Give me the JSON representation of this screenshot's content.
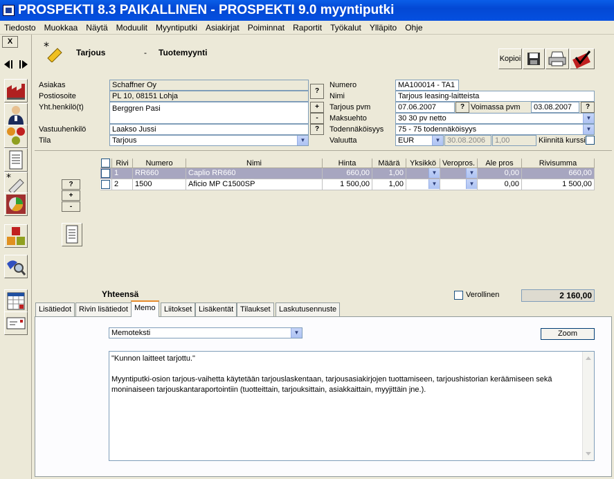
{
  "window": {
    "title": "PROSPEKTI 8.3 PAIKALLINEN - PROSPEKTI 9.0 myyntiputki"
  },
  "menu": [
    "Tiedosto",
    "Muokkaa",
    "Näytä",
    "Moduulit",
    "Myyntiputki",
    "Asiakirjat",
    "Poiminnat",
    "Raportit",
    "Työkalut",
    "Ylläpito",
    "Ohje"
  ],
  "close_label": "X",
  "header": {
    "module": "Tarjous",
    "separator": "-",
    "type": "Tuotemyynti",
    "copy_label": "Kopioi"
  },
  "form": {
    "asiakas_label": "Asiakas",
    "asiakas": "Schaffner Oy",
    "postiosoite_label": "Postiosoite",
    "postiosoite": "PL 10, 08151 Lohja",
    "yht_label": "Yht.henkilö(t)",
    "yht": "Berggren Pasi",
    "vastuu_label": "Vastuuhenkilö",
    "vastuu": "Laakso Jussi",
    "tila_label": "Tila",
    "tila": "Tarjous",
    "numero_label": "Numero",
    "numero": "MA100014 - TA1",
    "nimi_label": "Nimi",
    "nimi": "Tarjous leasing-laitteista",
    "pvm_label": "Tarjous pvm",
    "pvm": "07.06.2007",
    "voimassa_label": "Voimassa pvm",
    "voimassa": "03.08.2007",
    "maksuehto_label": "Maksuehto",
    "maksuehto": "30 30 pv netto",
    "todnak_label": "Todennäköisyys",
    "todnak": "75 - 75 todennäköisyys",
    "valuutta_label": "Valuutta",
    "valuutta": "EUR",
    "valuutta_pvm": "30.08.2006",
    "kurssi": "1,00",
    "kiinnita_label": "Kiinnitä kurssi",
    "q": "?",
    "plus": "+",
    "minus": "-"
  },
  "grid": {
    "headers": [
      "Rivi",
      "Numero",
      "Nimi",
      "Hinta",
      "Määrä",
      "Yksikkö",
      "Veropros.",
      "Ale pros",
      "Rivisumma"
    ],
    "rows": [
      {
        "rivi": "1",
        "numero": "RR660",
        "nimi": "Caplio RR660",
        "hinta": "660,00",
        "maara": "1,00",
        "ale": "0,00",
        "summa": "660,00"
      },
      {
        "rivi": "2",
        "numero": "1500",
        "nimi": "Aficio MP C1500SP",
        "hinta": "1 500,00",
        "maara": "1,00",
        "ale": "0,00",
        "summa": "1 500,00"
      }
    ]
  },
  "totals": {
    "label": "Yhteensä",
    "verollinen_label": "Verollinen",
    "sum": "2 160,00"
  },
  "tabs": [
    "Lisätiedot",
    "Rivin lisätiedot",
    "Memo",
    "Liitokset",
    "Lisäkentät",
    "Tilaukset",
    "Laskutusennuste"
  ],
  "memo": {
    "type": "Memoteksti",
    "zoom_label": "Zoom",
    "p1": "\"Kunnon laitteet tarjottu.\"",
    "p2": "Myyntiputki-osion tarjous-vaihetta käytetään tarjouslaskentaan, tarjousasiakirjojen tuottamiseen, tarjoushistorian keräämiseen sekä moninaiseen tarjouskantaraportointiin (tuotteittain, tarjouksittain, asiakkaittain, myyjittäin jne.)."
  }
}
